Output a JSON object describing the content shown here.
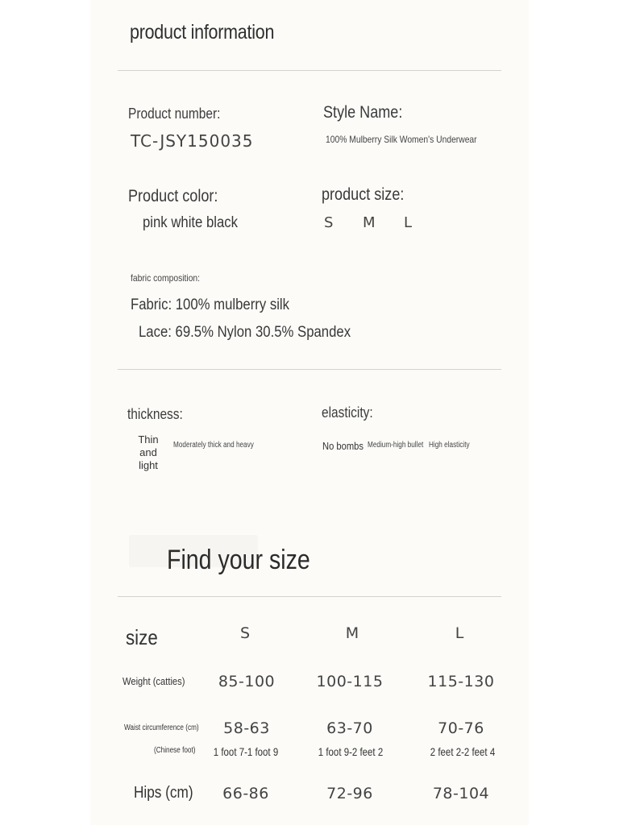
{
  "product_info": {
    "heading": "product information",
    "number_label": "Product number:",
    "number_value": "TC-JSY150035",
    "style_label": "Style Name:",
    "style_value": "100% Mulberry Silk Women's Underwear",
    "color_label": "Product color:",
    "color_value": "pink white black",
    "size_label": "product size:",
    "sizes": [
      "S",
      "M",
      "L"
    ],
    "fabric_label": "fabric composition:",
    "fabric_line1": "Fabric: 100% mulberry silk",
    "fabric_line2": "Lace: 69.5% Nylon 30.5% Spandex",
    "thickness_label": "thickness:",
    "thickness_opt1": "Thin and light",
    "thickness_opt2": "Moderately thick and heavy",
    "elasticity_label": "elasticity:",
    "elasticity_opt1": "No bombs",
    "elasticity_opt2": "Medium-high bullet",
    "elasticity_opt3": "High elasticity"
  },
  "size_chart": {
    "heading": "Find your size",
    "size_col_label": "size",
    "columns": [
      "S",
      "M",
      "L"
    ],
    "weight_label": "Weight (catties)",
    "weight_values": [
      "85-100",
      "100-115",
      "115-130"
    ],
    "waist_label": "Waist circumference (cm)",
    "waist_values": [
      "58-63",
      "63-70",
      "70-76"
    ],
    "waist_sub_label": "(Chinese foot)",
    "waist_feet_values": [
      "1 foot 7-1 foot 9",
      "1 foot 9-2 feet 2",
      "2 feet 2-2 feet 4"
    ],
    "hips_label": "Hips (cm)",
    "hips_values": [
      "66-86",
      "72-96",
      "78-104"
    ]
  }
}
